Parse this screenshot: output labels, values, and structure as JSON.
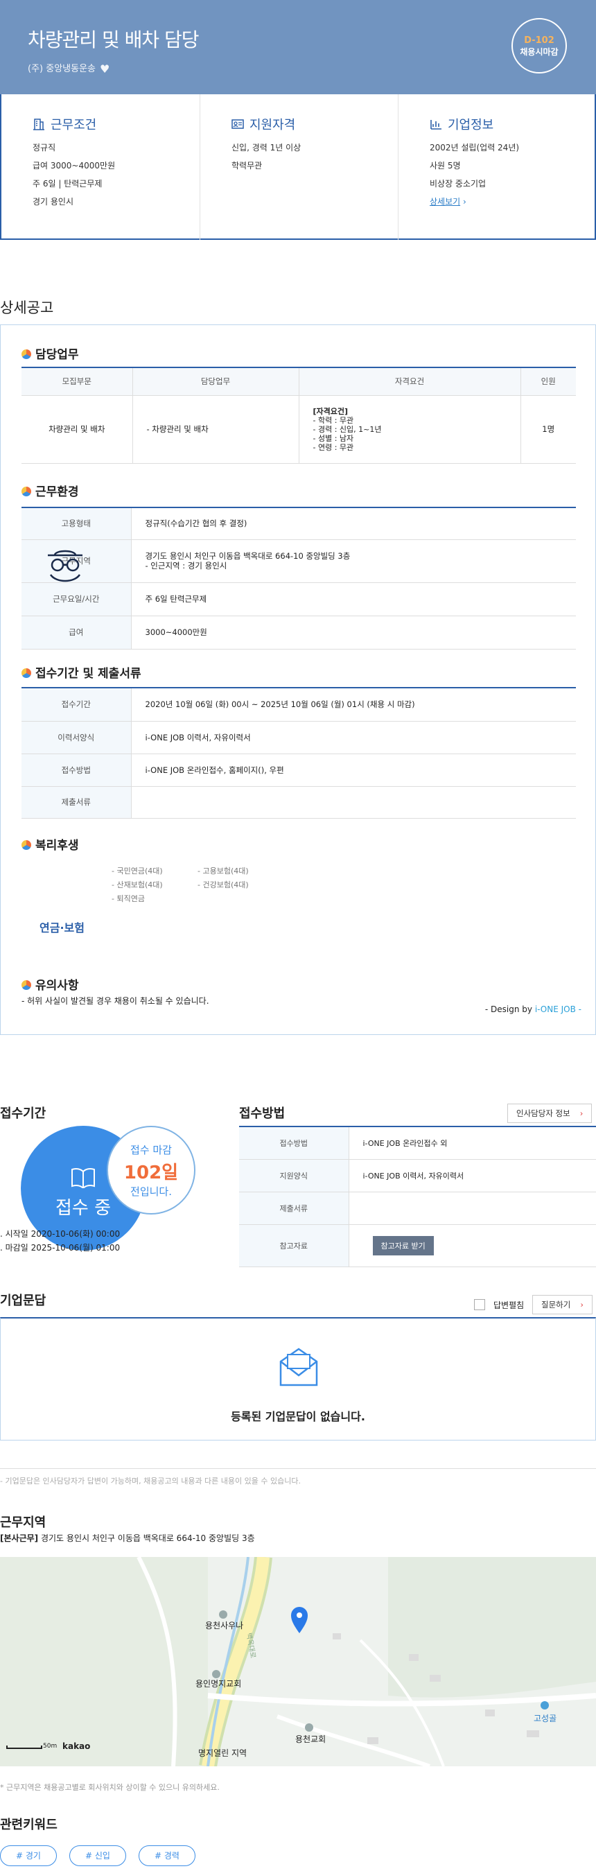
{
  "header": {
    "title": "차량관리 및 배차 담당",
    "company": "(주) 중앙냉동운송",
    "dday": "D-102",
    "dday_status": "채용시마감"
  },
  "summary": {
    "conditions": {
      "title": "근무조건",
      "items": [
        "정규직",
        "급여 3000~4000만원",
        "주 6일 | 탄력근무제",
        "경기 용인시"
      ]
    },
    "qualify": {
      "title": "지원자격",
      "items": [
        "신입, 경력 1년 이상",
        "학력무관"
      ]
    },
    "company": {
      "title": "기업정보",
      "items": [
        "2002년 설립(업력 24년)",
        "사원 5명",
        "비상장 중소기업"
      ],
      "link": "상세보기"
    }
  },
  "detail": {
    "title": "상세공고",
    "duty": {
      "title": "담당업무",
      "headers": [
        "모집부문",
        "담당업무",
        "자격요건",
        "인원"
      ],
      "part": "차량관리 및 배차",
      "task": "- 차량관리 및 배차",
      "req_title": "[자격요건]",
      "req": [
        "- 학력 : 무관",
        "- 경력 : 신입, 1~1년",
        "- 성별 : 남자",
        "- 연령 : 무관"
      ],
      "count": "1명"
    },
    "env": {
      "title": "근무환경",
      "rows": [
        {
          "k": "고용형태",
          "v": "정규직(수습기간 협의 후 결정)"
        },
        {
          "k": "근무지역",
          "v": "경기도 용인시 처인구 이동읍 백옥대로 664-10 중앙빌딩 3층",
          "v2": "- 인근지역 : 경기 용인시"
        },
        {
          "k": "근무요일/시간",
          "v": "주 6일 탄력근무제"
        },
        {
          "k": "급여",
          "v": "3000~4000만원"
        }
      ]
    },
    "apply": {
      "title": "접수기간 및 제출서류",
      "rows": [
        {
          "k": "접수기간",
          "v": "2020년 10월 06일 (화) 00시 ~ 2025년 10월 06일 (월) 01시 (채용 시 마감)"
        },
        {
          "k": "이력서양식",
          "v": "i-ONE JOB 이력서, 자유이력서"
        },
        {
          "k": "접수방법",
          "v": "i-ONE JOB 온라인접수, 홈페이지(), 우편"
        },
        {
          "k": "제출서류",
          "v": ""
        }
      ]
    },
    "welfare": {
      "title": "복리후생",
      "label": "연금·보험",
      "col1": [
        "- 국민연금(4대)",
        "- 산재보험(4대)",
        "- 퇴직연금"
      ],
      "col2": [
        "- 고용보험(4대)",
        "- 건강보험(4대)"
      ]
    },
    "notice": {
      "title": "유의사항",
      "text": "- 허위 사실이 발견될 경우 채용이 취소될 수 있습니다."
    },
    "design_prefix": "- Design by ",
    "design_brand": "i-ONE JOB -"
  },
  "receipt": {
    "title": "접수기간",
    "status": "접수 중",
    "dd_a": "접수 마감",
    "dd_b": "102일",
    "dd_c": "전입니다.",
    "start": "시작일 2020-10-06(화) 00:00",
    "end": "마감일 2025-10-06(월) 01:00"
  },
  "method": {
    "title": "접수방법",
    "contact_btn": "인사담당자 정보",
    "rows": [
      {
        "k": "접수방법",
        "v": "i-ONE JOB 온라인접수 외"
      },
      {
        "k": "지원양식",
        "v": "i-ONE JOB 이력서, 자유이력서"
      },
      {
        "k": "제출서류",
        "v": ""
      },
      {
        "k": "참고자료",
        "btn": "참고자료 받기"
      }
    ]
  },
  "qa": {
    "title": "기업문답",
    "toggle": "답변펼침",
    "ask": "질문하기",
    "empty": "등록된 기업문답이 없습니다.",
    "note": "- 기업문답은 인사담당자가 답변이 가능하며, 채용공고의 내용과 다른 내용이 있을 수 있습니다."
  },
  "location": {
    "title": "근무지역",
    "tag": "[본사근무]",
    "addr": "경기도 용인시 처인구 이동읍 백옥대로 664-10 중앙빌딩 3층",
    "note": "* 근무지역은 채용공고별로 회사위치와 상이할 수 있으니 유의하세요.",
    "map": {
      "labels": [
        "용천사우나",
        "용인명지교회",
        "용천교회",
        "명지열린 지역",
        "고성골"
      ],
      "road": "백옥대로",
      "scale": "50m",
      "brand": "kakao"
    }
  },
  "keywords": {
    "title": "관련키워드",
    "items": [
      "# 경기",
      "# 신입",
      "# 경력"
    ]
  },
  "colors": {
    "accent": "#2a5ea8",
    "hero": "#7194c0",
    "orange": "#f06d3a",
    "blue": "#3b8de6"
  }
}
